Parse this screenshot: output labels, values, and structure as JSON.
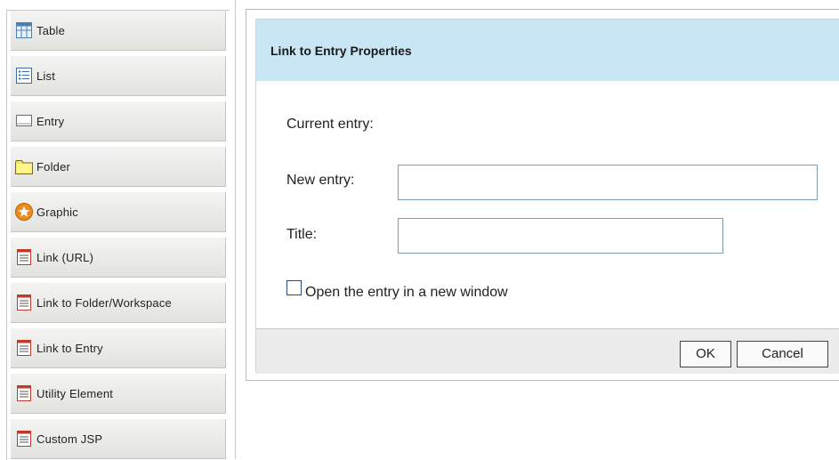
{
  "palette": {
    "items": [
      {
        "label": "Table",
        "icon": "table-icon"
      },
      {
        "label": "List",
        "icon": "list-icon"
      },
      {
        "label": "Entry",
        "icon": "entry-icon"
      },
      {
        "label": "Folder",
        "icon": "folder-icon"
      },
      {
        "label": "Graphic",
        "icon": "graphic-icon"
      },
      {
        "label": "Link (URL)",
        "icon": "link-url-icon"
      },
      {
        "label": "Link to Folder/Workspace",
        "icon": "link-folder-icon"
      },
      {
        "label": "Link to Entry",
        "icon": "link-entry-icon"
      },
      {
        "label": "Utility Element",
        "icon": "utility-element-icon"
      },
      {
        "label": "Custom JSP",
        "icon": "custom-jsp-icon"
      }
    ]
  },
  "dialog": {
    "title": "Link to Entry Properties",
    "current_entry_label": "Current entry:",
    "new_entry_label": "New entry:",
    "new_entry_value": "",
    "title_label": "Title:",
    "title_value": "",
    "new_window_label": "Open the entry in a new window",
    "new_window_checked": false,
    "ok_label": "OK",
    "cancel_label": "Cancel"
  },
  "colors": {
    "header_bg": "#c9e6f5",
    "footer_bg": "#ececec",
    "input_border": "#7f9db9"
  }
}
